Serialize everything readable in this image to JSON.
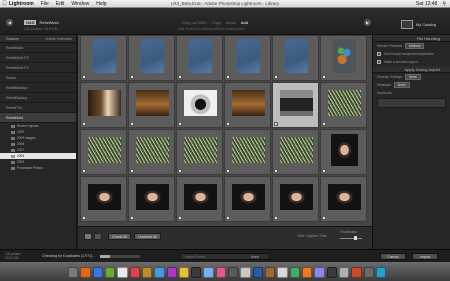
{
  "menubar": {
    "items": [
      "Lightroom",
      "File",
      "Edit",
      "Window",
      "Help"
    ],
    "window_title": "LR3_Beta.lrcat - Adobe Photoshop Lightroom - Library",
    "clock": "Sat 12:48",
    "user": "Q"
  },
  "topbar": {
    "source_tag": "NAS",
    "source_name": "RebelMold",
    "source_sub": "132 photos / 23.0 GB",
    "modes": [
      "Copy as DNG",
      "Copy",
      "Move",
      "Add"
    ],
    "modes_selected": "Add",
    "modes_sub": "Add photos to catalog without moving them",
    "catalog_label": "My Catalog"
  },
  "left": {
    "header": "Source",
    "include_subfolders": "Include Subfolders",
    "sources": [
      "RebelMold",
      "RebelMold PZ",
      "RebelMold PZ",
      "Scans",
      "RebelBackup",
      "RebelBackup",
      "RebelFSS",
      "RebelMold"
    ],
    "folders": [
      "Recent Imports",
      "2009",
      "2009 Images",
      "2008",
      "2007",
      "2006",
      "2005",
      "Processed Photos"
    ],
    "highlighted_folder": "2006"
  },
  "right": {
    "file_handling_header": "File Handling",
    "render_label": "Render Previews",
    "render_value": "Minimal",
    "dont_import": "Don't import suspected duplicates",
    "make_backup": "Make a second copy to:",
    "apply_header": "Apply During Import",
    "dev_label": "Develop Settings",
    "dev_value": "None",
    "metadata_label": "Metadata",
    "metadata_value": "None",
    "keywords_label": "Keywords"
  },
  "toolbar": {
    "check_all": "Check All",
    "uncheck_all": "Uncheck All",
    "sort_label": "Sort: Capture Time",
    "thumbnails_label": "Thumbnails"
  },
  "status": {
    "info_line1": "132 photos",
    "info_line2": "23.00 GB",
    "progress_label": "Checking for Duplicates (17/71)...",
    "progress_fraction": 0.24,
    "preset_label": "Import Preset:",
    "preset_value": "None",
    "cancel": "Cancel",
    "import": "Import"
  },
  "grid": {
    "thumbs": [
      "blue",
      "blue",
      "blue",
      "blue",
      "blue",
      "blurbag",
      "studio",
      "wood",
      "dark",
      "wood",
      "tv",
      "grass",
      "grass",
      "grass",
      "grass",
      "grass",
      "grass",
      "child",
      "child",
      "child",
      "child",
      "child",
      "child",
      "child"
    ],
    "selected_index": 10
  },
  "dock": {
    "colors": [
      "#7a7a7a",
      "#d86a28",
      "#3a78d8",
      "#6fa83a",
      "#e8e8e8",
      "#d84a4a",
      "#c08a30",
      "#4a9ad8",
      "#aa3ac8",
      "#e8c03a",
      "#3a3a3a",
      "#7ab0e0",
      "#e05a8a",
      "#5a5a5a",
      "#c8c8c8",
      "#2a5aa8",
      "#9a6a3a",
      "#d8d8d8",
      "#4aa86a",
      "#e87a2a",
      "#8a8ae0",
      "#3a3a3a",
      "#b0b0b0",
      "#c84a2a",
      "#6a6a6a",
      "#2aa0c8"
    ]
  }
}
